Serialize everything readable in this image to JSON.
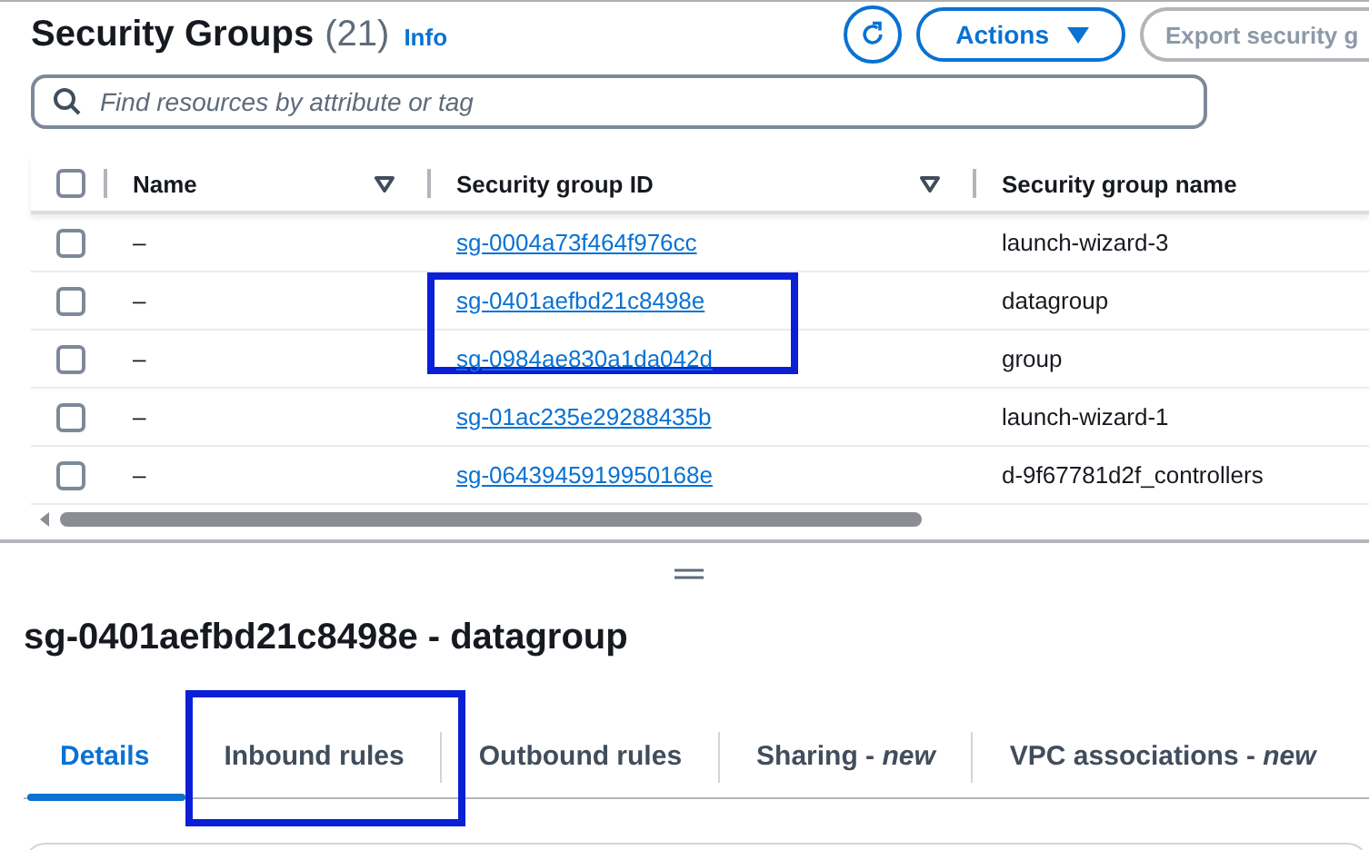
{
  "header": {
    "title": "Security Groups",
    "count": "(21)",
    "info": "Info",
    "actions": "Actions",
    "export": "Export security g"
  },
  "search": {
    "placeholder": "Find resources by attribute or tag"
  },
  "table": {
    "all_checked": false,
    "columns": [
      {
        "label": "Name",
        "sortable": true
      },
      {
        "label": "Security group ID",
        "sortable": true
      },
      {
        "label": "Security group name",
        "sortable": false
      }
    ],
    "rows": [
      {
        "checked": false,
        "name": "–",
        "id": "sg-0004a73f464f976cc",
        "group": "launch-wizard-3",
        "highlighted": false
      },
      {
        "checked": false,
        "name": "–",
        "id": "sg-0401aefbd21c8498e",
        "group": "datagroup",
        "highlighted": true
      },
      {
        "checked": false,
        "name": "–",
        "id": "sg-0984ae830a1da042d",
        "group": "group",
        "highlighted": false
      },
      {
        "checked": false,
        "name": "–",
        "id": "sg-01ac235e29288435b",
        "group": "launch-wizard-1",
        "highlighted": false
      },
      {
        "checked": false,
        "name": "–",
        "id": "sg-0643945919950168e",
        "group": "d-9f67781d2f_controllers",
        "highlighted": false
      }
    ]
  },
  "detail": {
    "title": "sg-0401aefbd21c8498e - datagroup",
    "tabs": [
      {
        "label": "Details",
        "selected": true,
        "highlighted": false
      },
      {
        "label": "Inbound rules",
        "selected": false,
        "highlighted": true
      },
      {
        "label": "Outbound rules",
        "selected": false,
        "highlighted": false
      },
      {
        "label": "Sharing - *new*",
        "selected": false,
        "highlighted": false
      },
      {
        "label": "VPC associations - *new*",
        "selected": false,
        "highlighted": false
      }
    ]
  }
}
